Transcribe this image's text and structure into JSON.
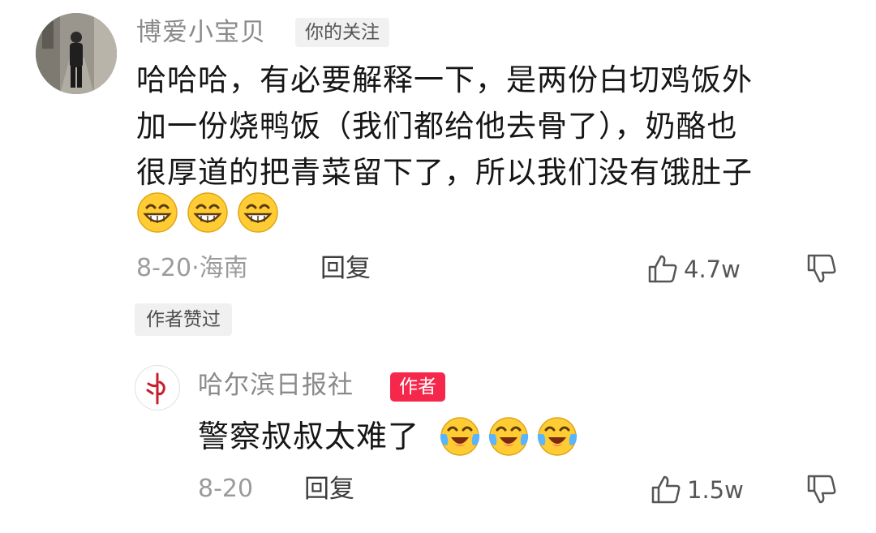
{
  "comment": {
    "author_name": "博爱小宝贝",
    "follow_tag": "你的关注",
    "text_lines": [
      "哈哈哈，有必要解释一下，是两份白切鸡饭外",
      "加一份烧鸭饭（我们都给他去骨了），奶酪也",
      "很厚道的把青菜留下了，所以我们没有饿肚子"
    ],
    "emojis": [
      "grin-emoji",
      "grin-emoji",
      "grin-emoji"
    ],
    "meta": "8-20·海南",
    "reply_label": "回复",
    "like_count": "4.7w",
    "author_liked_tag": "作者赞过"
  },
  "reply": {
    "author_name": "哈尔滨日报社",
    "author_tag": "作者",
    "text": "警察叔叔太难了",
    "emojis": [
      "tears-of-joy-emoji",
      "tears-of-joy-emoji",
      "tears-of-joy-emoji"
    ],
    "meta": "8-20",
    "reply_label": "回复",
    "like_count": "1.5w"
  },
  "colors": {
    "author_tag_bg": "#f5284b",
    "emoji_yellow": "#ffcc33",
    "tear_blue": "#5ab4ff"
  },
  "icons": {
    "like": "thumbs-up-outline-icon",
    "dislike": "thumbs-down-outline-icon"
  }
}
